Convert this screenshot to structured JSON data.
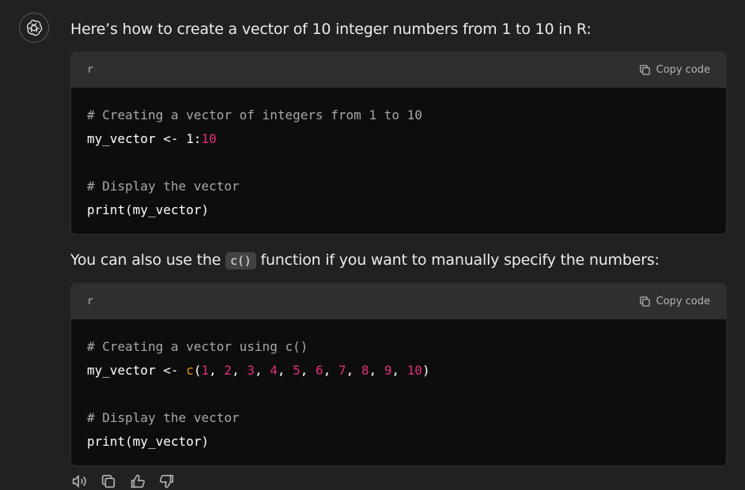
{
  "message": {
    "intro_prefix": "Here’s how to create a vector of 10 integer numbers from 1 to 10 in R:",
    "middle_prefix": "You can also use the ",
    "middle_code": "c()",
    "middle_suffix": " function if you want to manually specify the numbers:"
  },
  "code_blocks": [
    {
      "language": "r",
      "copy_label": "Copy code",
      "lines": {
        "l1": "# Creating a vector of integers from 1 to 10",
        "l2_a": "my_vector <- 1:",
        "l2_b": "10",
        "l3": "# Display the vector",
        "l4": "print(my_vector)"
      }
    },
    {
      "language": "r",
      "copy_label": "Copy code",
      "lines": {
        "l1": "# Creating a vector using c()",
        "l2_a": "my_vector <- ",
        "l2_fn": "c",
        "l2_open": "(",
        "nums": [
          "1",
          "2",
          "3",
          "4",
          "5",
          "6",
          "7",
          "8",
          "9",
          "10"
        ],
        "sep": ", ",
        "l2_close": ")",
        "l3": "# Display the vector",
        "l4": "print(my_vector)"
      }
    }
  ],
  "actions": [
    "read-aloud-icon",
    "copy-icon",
    "thumbs-up-icon",
    "thumbs-down-icon"
  ],
  "colors": {
    "background": "#212121",
    "code_bg": "#0d0d0d",
    "code_header_bg": "#2f2f2f",
    "comment": "#a8a8a8",
    "number": "#df3079",
    "function": "#e9950c"
  }
}
